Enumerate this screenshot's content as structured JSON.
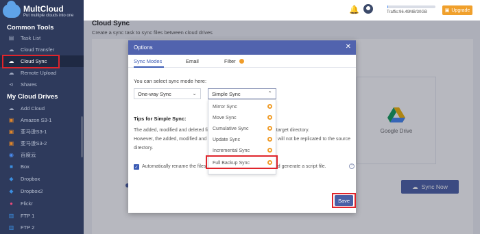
{
  "app": {
    "name": "MultCloud",
    "tagline": "Put multiple clouds into one"
  },
  "sidebar": {
    "common_tools_title": "Common Tools",
    "common_tools": [
      {
        "label": "Task List",
        "icon": "clipboard-icon"
      },
      {
        "label": "Cloud Transfer",
        "icon": "transfer-icon"
      },
      {
        "label": "Cloud Sync",
        "icon": "sync-icon",
        "active": true
      },
      {
        "label": "Remote Upload",
        "icon": "upload-icon"
      },
      {
        "label": "Shares",
        "icon": "share-icon"
      }
    ],
    "my_drives_title": "My Cloud Drives",
    "drives": [
      {
        "label": "Add Cloud",
        "icon": "add-cloud-icon"
      },
      {
        "label": "Amazon S3-1",
        "icon": "amazon-s3-icon"
      },
      {
        "label": "亚马逊S3-1",
        "icon": "amazon-s3-icon"
      },
      {
        "label": "亚马逊S3-2",
        "icon": "amazon-s3-icon"
      },
      {
        "label": "百度云",
        "icon": "baidu-icon"
      },
      {
        "label": "Box",
        "icon": "box-icon"
      },
      {
        "label": "Dropbox",
        "icon": "dropbox-icon"
      },
      {
        "label": "Dropbox2",
        "icon": "dropbox-icon"
      },
      {
        "label": "Flickr",
        "icon": "flickr-icon"
      },
      {
        "label": "FTP 1",
        "icon": "ftp-icon"
      },
      {
        "label": "FTP 2",
        "icon": "ftp-icon"
      }
    ]
  },
  "topbar": {
    "traffic": "Traffic:96.49MB/30GB",
    "traffic_fraction": 0.003,
    "upgrade": "Upgrade"
  },
  "page": {
    "title": "Cloud Sync",
    "subtitle": "Create a sync task to sync files between cloud drives",
    "target_label": "Google Drive",
    "sync_now": "Sync Now"
  },
  "dialog": {
    "title": "Options",
    "tabs": [
      "Sync Modes",
      "Email",
      "Filter"
    ],
    "mode_prompt": "You can select sync mode here:",
    "sync_direction": "One-way Sync",
    "selected_mode": "Simple Sync",
    "modes": [
      "Mirror Sync",
      "Move Sync",
      "Cumulative Sync",
      "Update Sync",
      "Incremental Sync",
      "Full Backup Sync"
    ],
    "tips_title": "Tips for Simple Sync:",
    "tips_line1a": "The added, modified and deleted fil",
    "tips_line1b": "replicated to the target directory.",
    "tips_line2a": "However, the added, modified and d",
    "tips_line2b": "y will not be replicated to the source",
    "tips_line3": "directory.",
    "rename_a": "Automatically rename the files",
    "rename_b": "and generate a script file.",
    "save": "Save"
  },
  "colors": {
    "sidebar_bg": "#2e3a5c",
    "accent": "#5163ae",
    "highlight": "#e0242b",
    "upgrade": "#f0a02c"
  }
}
